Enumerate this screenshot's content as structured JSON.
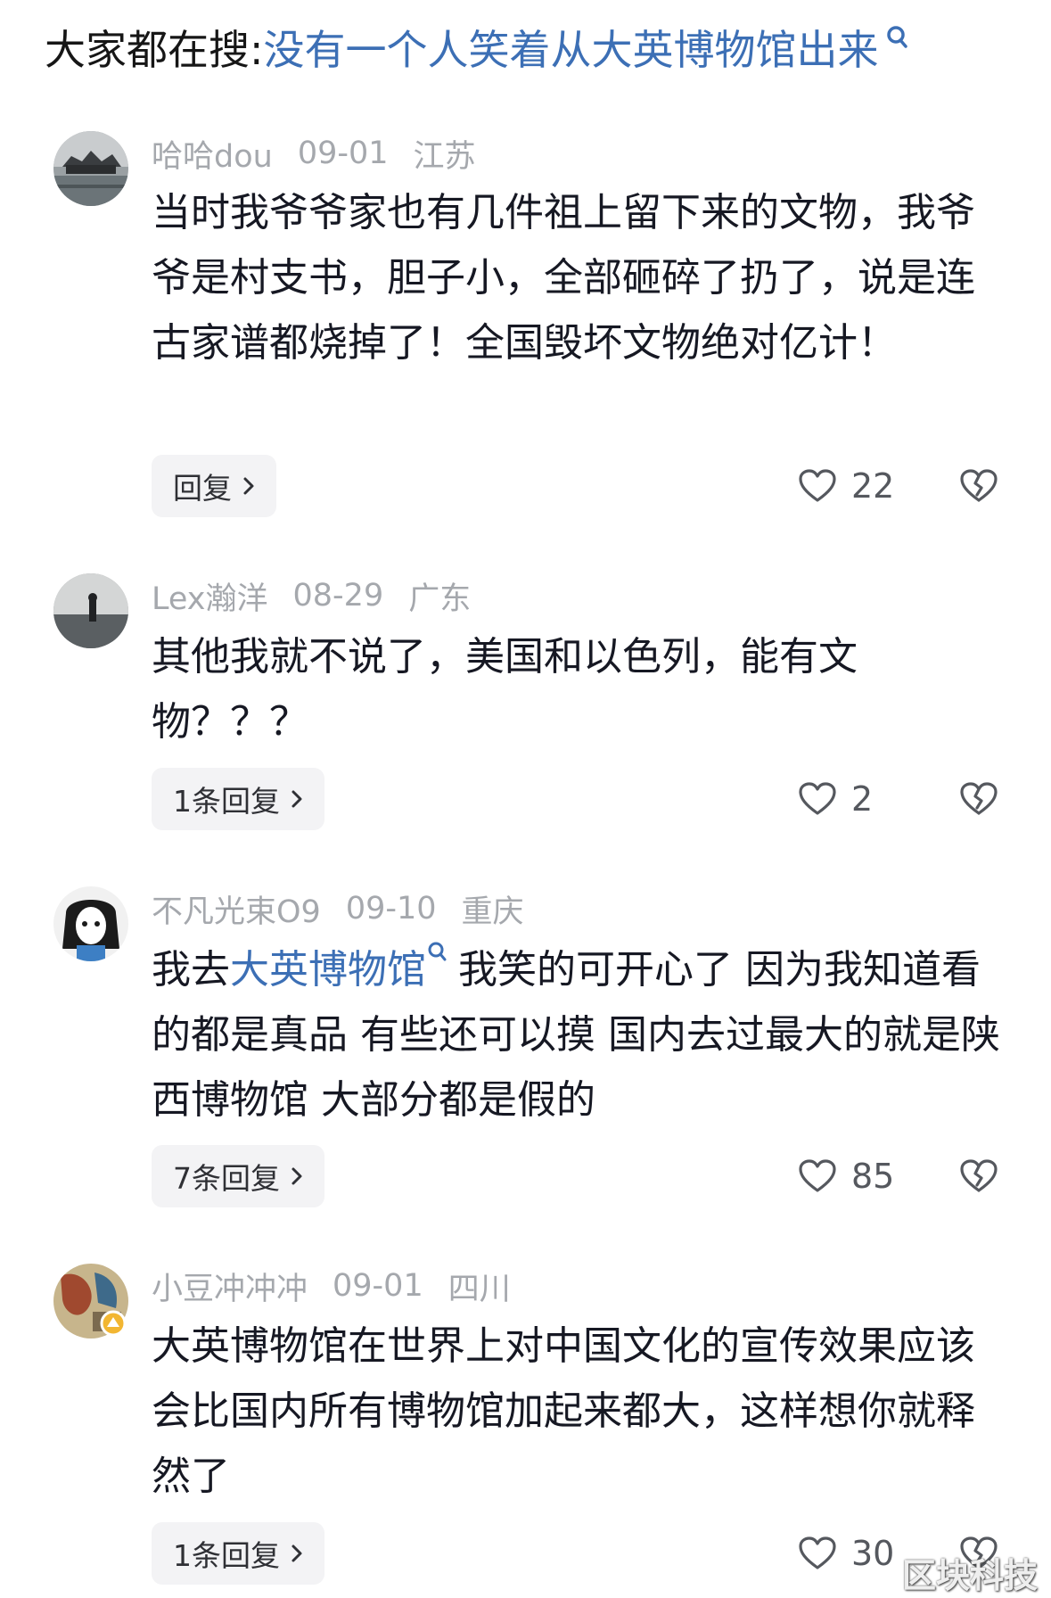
{
  "search": {
    "prefix": "大家都在搜: ",
    "query": "没有一个人笑着从大英博物馆出来"
  },
  "comments": [
    {
      "username": "哈哈dou",
      "date": "09-01",
      "location": "江苏",
      "text": "当时我爷爷家也有几件祖上留下来的文物，我爷爷是村支书，胆子小，全部砸碎了扔了，说是连古家谱都烧掉了！全国毁坏文物绝对亿计！",
      "reply_label": "回复",
      "likes": "22",
      "avatar_icon": "pavilion-avatar"
    },
    {
      "username": "Lex瀚洋",
      "date": "08-29",
      "location": "广东",
      "text": "其他我就不说了，美国和以色列，能有文物？？？",
      "reply_label": "1条回复",
      "likes": "2",
      "avatar_icon": "silhouette-avatar"
    },
    {
      "username": "不凡光束O9",
      "date": "09-10",
      "location": "重庆",
      "text_before": "我去",
      "text_link": "大英博物馆",
      "text_after": "我笑的可开心了 因为我知道看的都是真品 有些还可以摸 国内去过最大的就是陕西博物馆 大部分都是假的",
      "reply_label": "7条回复",
      "likes": "85",
      "avatar_icon": "cartoon-girl-avatar"
    },
    {
      "username": "小豆冲冲冲",
      "date": "09-01",
      "location": "四川",
      "text": "大英博物馆在世界上对中国文化的宣传效果应该会比国内所有博物馆加起来都大，这样想你就释然了",
      "reply_label": "1条回复",
      "likes": "30",
      "avatar_icon": "painting-avatar"
    }
  ],
  "watermark": "区块科技",
  "colors": {
    "link": "#3c6fb5",
    "meta": "#a5a8ad",
    "pill_bg": "#f3f3f5"
  }
}
